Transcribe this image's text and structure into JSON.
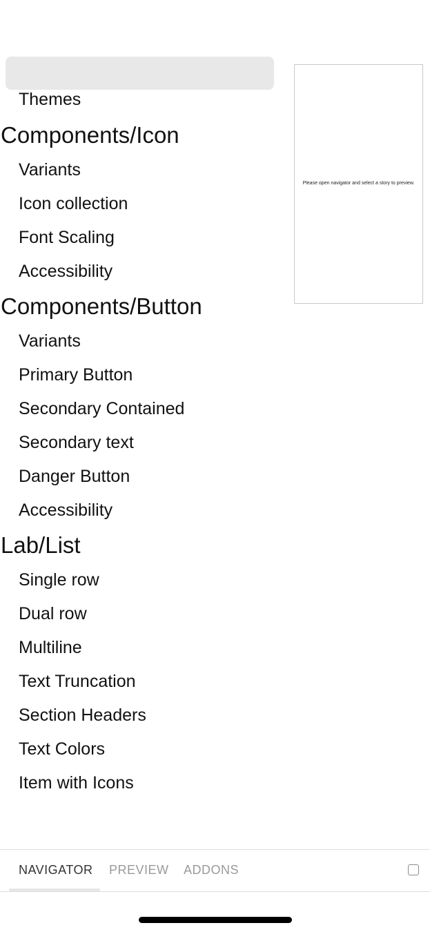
{
  "search": {
    "placeholder": ""
  },
  "navigator": {
    "partial_item": "Themes",
    "groups": [
      {
        "title": "Components/Icon",
        "items": [
          "Variants",
          "Icon collection",
          "Font Scaling",
          "Accessibility"
        ]
      },
      {
        "title": "Components/Button",
        "items": [
          "Variants",
          "Primary Button",
          "Secondary Contained",
          "Secondary text",
          "Danger Button",
          "Accessibility"
        ]
      },
      {
        "title": "Lab/List",
        "items": [
          "Single row",
          "Dual row",
          "Multiline",
          "Text Truncation",
          "Section Headers",
          "Text Colors",
          "Item with Icons"
        ]
      }
    ]
  },
  "preview": {
    "message": "Please open navigator and select a story to preview."
  },
  "tabs": {
    "navigator": "NAVIGATOR",
    "preview": "PREVIEW",
    "addons": "ADDONS",
    "active": "navigator"
  },
  "icons": {
    "fullscreen": "square-outline-icon"
  },
  "colors": {
    "search_bg": "#e8e8e8",
    "tab_active": "#333333",
    "tab_inactive": "#9a9a9a"
  }
}
